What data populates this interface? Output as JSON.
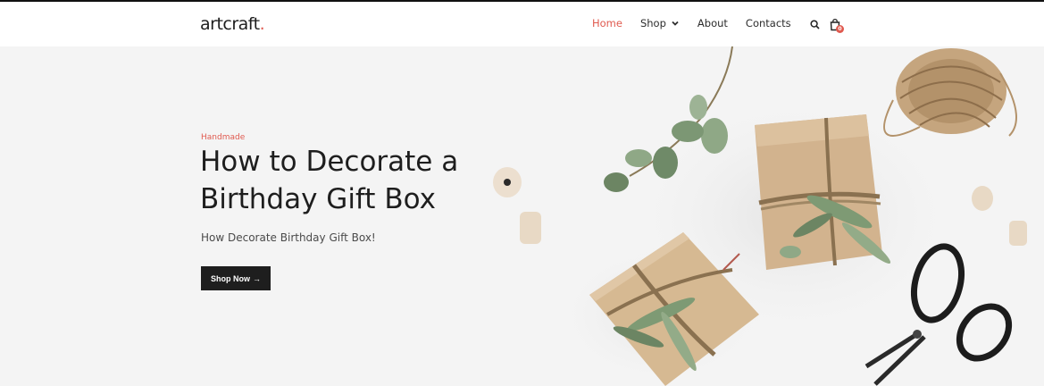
{
  "header": {
    "logo_text": "artcraft",
    "logo_dot": ".",
    "nav": [
      {
        "label": "Home"
      },
      {
        "label": "Shop"
      },
      {
        "label": "About"
      },
      {
        "label": "Contacts"
      }
    ],
    "cart_count": "0",
    "icons": [
      "search-icon",
      "bag-icon",
      "chevron-down-icon"
    ]
  },
  "hero": {
    "eyebrow": "Handmade",
    "title": "How to Decorate a Birthday Gift Box",
    "subtitle": "How Decorate Birthday Gift Box!",
    "cta_label": "Shop Now",
    "cta_arrow": "→"
  },
  "colors": {
    "accent": "#e05a4f",
    "dark": "#1e1e1e",
    "hero_bg": "#f4f4f4"
  }
}
